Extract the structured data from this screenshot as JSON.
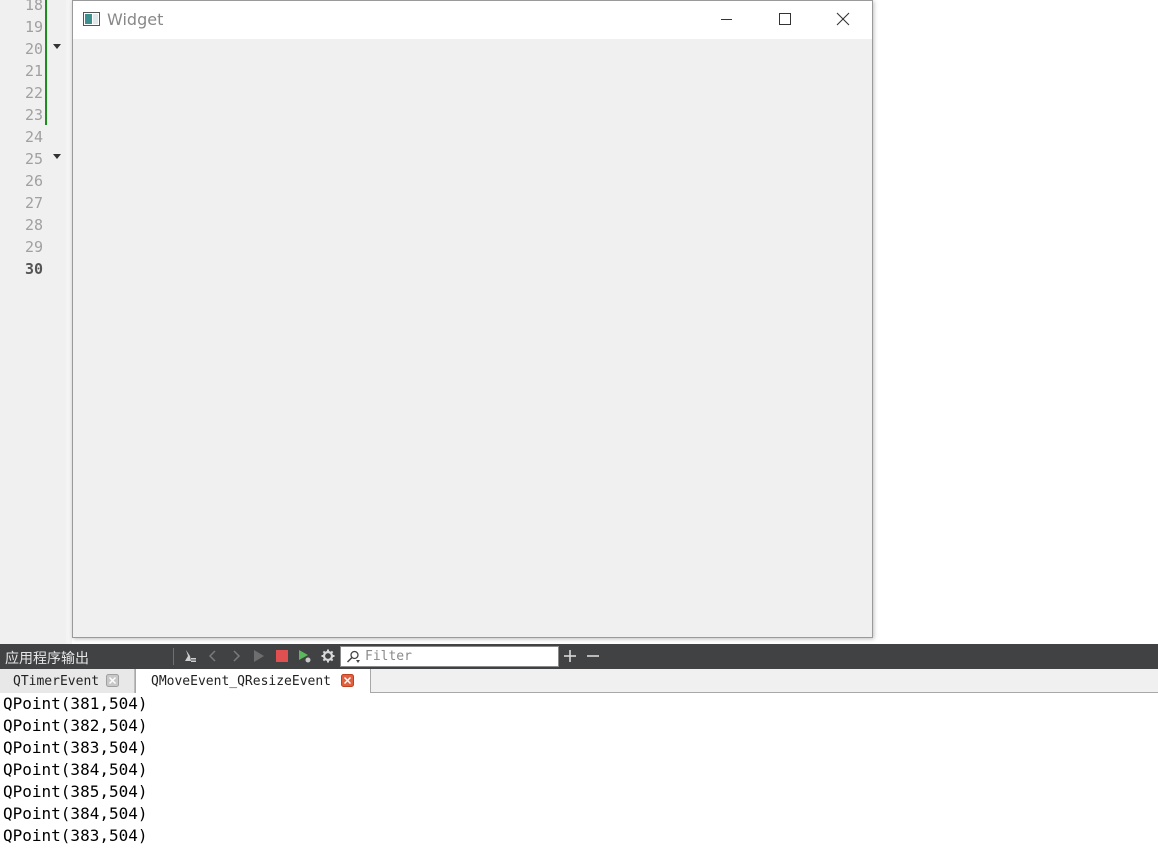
{
  "editor": {
    "line_numbers": [
      "18",
      "19",
      "20",
      "21",
      "22",
      "23",
      "24",
      "25",
      "26",
      "27",
      "28",
      "29",
      "30"
    ],
    "current_line": "30"
  },
  "window": {
    "title": "Widget",
    "controls": [
      "minimize",
      "maximize",
      "close"
    ]
  },
  "output_pane": {
    "title": "应用程序输出",
    "filter_placeholder": "Filter",
    "toolbar_icons": [
      "clear-icon",
      "previous-icon",
      "next-icon",
      "run-icon",
      "stop-icon",
      "debug-run-icon",
      "settings-icon",
      "filter-icon",
      "zoom-in-icon",
      "zoom-out-icon"
    ],
    "tabs": [
      {
        "label": "QTimerEvent",
        "active": false
      },
      {
        "label": "QMoveEvent_QResizeEvent",
        "active": true
      }
    ],
    "lines": [
      "QPoint(381,504)",
      "QPoint(382,504)",
      "QPoint(383,504)",
      "QPoint(384,504)",
      "QPoint(385,504)",
      "QPoint(384,504)",
      "QPoint(383,504)"
    ]
  },
  "colors": {
    "toolbar_bg": "#404244",
    "change_bar": "#1e8c1e",
    "stop_red": "#e05050",
    "tab_close_active": "#e06040"
  }
}
